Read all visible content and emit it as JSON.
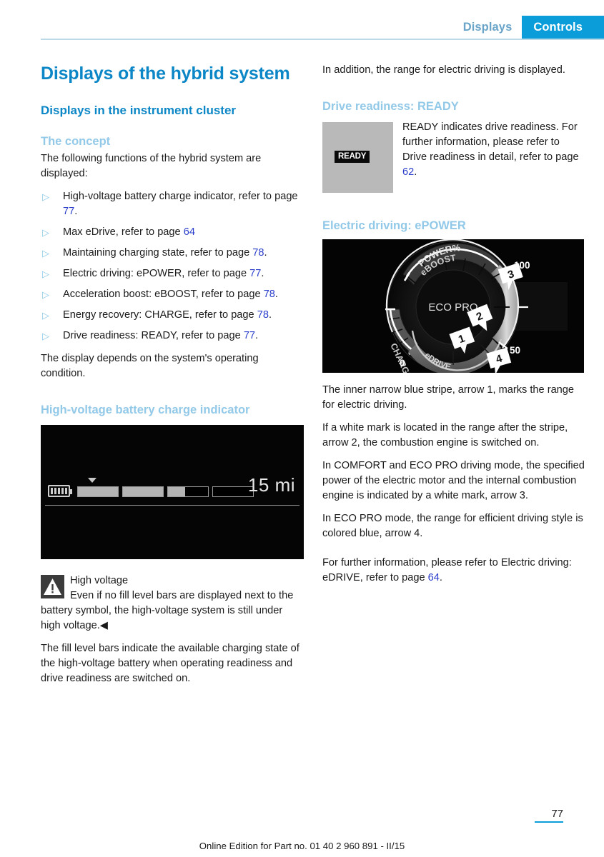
{
  "header": {
    "tab_inactive": "Displays",
    "tab_active": "Controls"
  },
  "left": {
    "title": "Displays of the hybrid system",
    "subtitle": "Displays in the instrument cluster",
    "concept_heading": "The concept",
    "concept_intro": "The following functions of the hybrid system are displayed:",
    "bullets": [
      {
        "bullet_icon": "triangle-right-icon",
        "text": "High-voltage battery charge indicator, refer to page ",
        "page": "77",
        "tail": "."
      },
      {
        "bullet_icon": "triangle-right-icon",
        "text": "Max eDrive, refer to page ",
        "page": "64",
        "tail": ""
      },
      {
        "bullet_icon": "triangle-right-icon",
        "text": "Maintaining charging state, refer to page ",
        "page": "78",
        "tail": "."
      },
      {
        "bullet_icon": "triangle-right-icon",
        "text": "Electric driving: ePOWER, refer to page ",
        "page": "77",
        "tail": "."
      },
      {
        "bullet_icon": "triangle-right-icon",
        "text": "Acceleration boost: eBOOST, refer to page ",
        "page": "78",
        "tail": "."
      },
      {
        "bullet_icon": "triangle-right-icon",
        "text": "Energy recovery: CHARGE, refer to page ",
        "page": "78",
        "tail": "."
      },
      {
        "bullet_icon": "triangle-right-icon",
        "text": "Drive readiness: READY, refer to page ",
        "page": "77",
        "tail": "."
      }
    ],
    "after_bullets": "The display depends on the system's operating condition.",
    "battery_heading": "High-voltage battery charge indicator",
    "battery_figure": {
      "icon": "battery-icon",
      "marker": "down-triangle-marker",
      "range_value": "15 mi",
      "segments": [
        {
          "fill_percent": 100
        },
        {
          "fill_percent": 100
        },
        {
          "fill_percent": 42
        },
        {
          "fill_percent": 0
        }
      ]
    },
    "notice": {
      "icon": "warning-triangle-icon",
      "title": "High voltage",
      "body": "Even if no fill level bars are displayed next to the battery symbol, the high-voltage system is still under high voltage.",
      "endmark": "◀"
    },
    "closing_paragraph": "The fill level bars indicate the available charging state of the high-voltage battery when operating readiness and drive readiness are switched on."
  },
  "right": {
    "intro": "In addition, the range for electric driving is displayed.",
    "ready_heading": "Drive readiness: READY",
    "ready_figure": {
      "chip_label": "READY"
    },
    "ready_text_1": "READY indicates drive readiness. For further information, please refer to Drive readiness in detail, refer to page ",
    "ready_page": "62",
    "ready_text_2": ".",
    "epower_heading": "Electric driving: ePOWER",
    "gauge_figure": {
      "labels": {
        "power": "POWER%",
        "eboost": "eBOOST",
        "eco_pro": "ECO PRO",
        "edrive": "eDRIVE",
        "charge": "CHARGE",
        "tick_zero": "0",
        "tick_fifty": "50",
        "tick_hundred": "100"
      },
      "callouts": [
        {
          "number": "1"
        },
        {
          "number": "2"
        },
        {
          "number": "3"
        },
        {
          "number": "4"
        }
      ]
    },
    "paragraphs": [
      "The inner narrow blue stripe, arrow 1, marks the range for electric driving.",
      "If a white mark is located in the range after the stripe, arrow 2, the combustion engine is switched on.",
      "In COMFORT and ECO PRO driving mode, the specified power of the electric motor and the internal combustion engine is indicated by a white mark, arrow 3.",
      "In ECO PRO mode, the range for efficient driving style is colored blue, arrow 4."
    ],
    "further_text": "For further information, please refer to Electric driving: eDRIVE, refer to page ",
    "further_page": "64",
    "further_tail": "."
  },
  "footer": {
    "text": "Online Edition for Part no. 01 40 2 960 891 - II/15",
    "page_number": "77"
  },
  "colors": {
    "accent": "#0b9dd9",
    "title_blue": "#0b86c6",
    "light_blue": "#92c9e8",
    "link_blue": "#2b3ecb",
    "bullet_blue": "#8cc8e6"
  }
}
